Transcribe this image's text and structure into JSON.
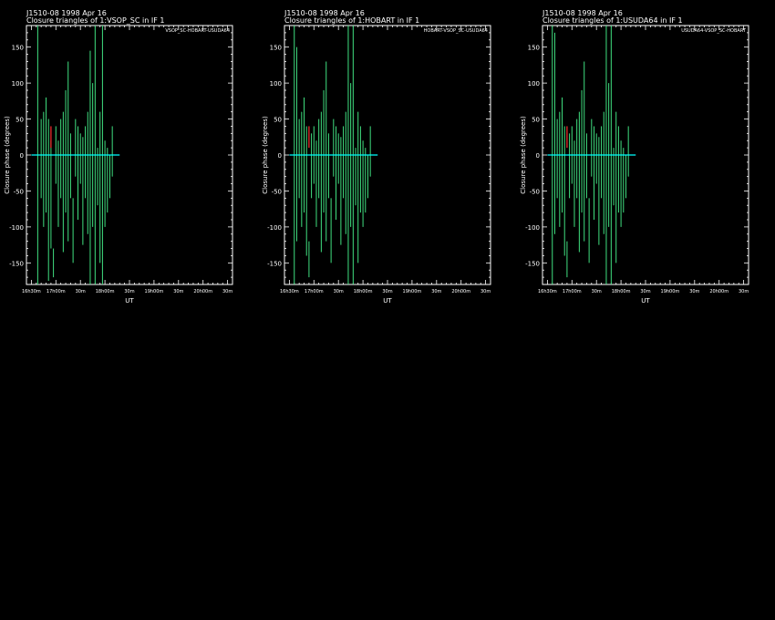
{
  "panels": [
    {
      "source_line": "J1510-08   1998 Apr 16",
      "title": "Closure triangles of 1:VSOP_SC in IF 1",
      "triangle_label": "VSOP_SC-HOBART-USUDA64",
      "zero_line_color": "#00ffff",
      "series_color": "#40e080",
      "marker_color": "#ff3030",
      "chart_data": {
        "type": "scatter",
        "xlabel": "UT",
        "ylabel": "Closure phase   (degrees)",
        "xlim": [
          16.4,
          20.6
        ],
        "ylim": [
          -180,
          180
        ],
        "yticks": [
          -150,
          -100,
          -50,
          0,
          50,
          100,
          150
        ],
        "xticks": [
          {
            "t": 16.5,
            "label": "16h30m"
          },
          {
            "t": 17.0,
            "label": "17h00m"
          },
          {
            "t": 17.5,
            "label": "30m"
          },
          {
            "t": 18.0,
            "label": "18h00m"
          },
          {
            "t": 18.5,
            "label": "30m"
          },
          {
            "t": 19.0,
            "label": "19h00m"
          },
          {
            "t": 19.5,
            "label": "30m"
          },
          {
            "t": 20.0,
            "label": "20h00m"
          },
          {
            "t": 20.5,
            "label": "30m"
          }
        ],
        "zero_line_x": [
          16.5,
          18.3
        ],
        "segments": [
          [
            16.6,
            -170
          ],
          [
            16.63,
            -180,
            180
          ],
          [
            16.7,
            -60,
            50
          ],
          [
            16.75,
            -100,
            60
          ],
          [
            16.8,
            -80,
            80
          ],
          [
            16.85,
            -175,
            50
          ],
          [
            16.9,
            -130,
            20
          ],
          [
            16.95,
            -170,
            -130
          ],
          [
            17.0,
            -40,
            40
          ],
          [
            17.05,
            -100,
            20
          ],
          [
            17.1,
            -60,
            50
          ],
          [
            17.15,
            -135,
            60
          ],
          [
            17.2,
            -80,
            90
          ],
          [
            17.25,
            -120,
            130
          ],
          [
            17.3,
            -60,
            30
          ],
          [
            17.35,
            -150,
            -60
          ],
          [
            17.4,
            -30,
            50
          ],
          [
            17.45,
            -90,
            40
          ],
          [
            17.5,
            -40,
            30
          ],
          [
            17.55,
            -125,
            25
          ],
          [
            17.6,
            -60,
            40
          ],
          [
            17.65,
            -110,
            60
          ],
          [
            17.7,
            -180,
            145
          ],
          [
            17.75,
            -100,
            100
          ],
          [
            17.8,
            -180,
            180
          ],
          [
            17.85,
            -70,
            10
          ],
          [
            17.9,
            -150,
            60
          ],
          [
            17.95,
            -180,
            180
          ],
          [
            18.0,
            -100,
            20
          ],
          [
            18.05,
            -80,
            10
          ],
          [
            18.1,
            -60,
            0
          ],
          [
            18.15,
            -30,
            40
          ]
        ],
        "markers": [
          [
            16.9,
            10,
            40
          ]
        ]
      }
    },
    {
      "source_line": "J1510-08   1998 Apr 16",
      "title": "Closure triangles of 1:HOBART in IF 1",
      "triangle_label": "HOBART-VSOP_SC-USUDA64",
      "zero_line_color": "#00ffff",
      "series_color": "#40e080",
      "marker_color": "#ff3030",
      "chart_data": {
        "type": "scatter",
        "xlabel": "UT",
        "ylabel": "Closure phase   (degrees)",
        "xlim": [
          16.4,
          20.6
        ],
        "ylim": [
          -180,
          180
        ],
        "yticks": [
          -150,
          -100,
          -50,
          0,
          50,
          100,
          150
        ],
        "xticks": [
          {
            "t": 16.5,
            "label": "16h30m"
          },
          {
            "t": 17.0,
            "label": "17h00m"
          },
          {
            "t": 17.5,
            "label": "30m"
          },
          {
            "t": 18.0,
            "label": "18h00m"
          },
          {
            "t": 18.5,
            "label": "30m"
          },
          {
            "t": 19.0,
            "label": "19h00m"
          },
          {
            "t": 19.5,
            "label": "30m"
          },
          {
            "t": 20.0,
            "label": "20h00m"
          },
          {
            "t": 20.5,
            "label": "30m"
          }
        ],
        "zero_line_x": [
          16.5,
          18.3
        ],
        "segments": [
          [
            16.6,
            -180,
            180
          ],
          [
            16.65,
            -120,
            150
          ],
          [
            16.7,
            -60,
            50
          ],
          [
            16.75,
            -100,
            60
          ],
          [
            16.8,
            -80,
            80
          ],
          [
            16.85,
            -140,
            40
          ],
          [
            16.9,
            -170,
            -120
          ],
          [
            16.95,
            -60,
            30
          ],
          [
            17.0,
            -40,
            40
          ],
          [
            17.05,
            -100,
            20
          ],
          [
            17.1,
            -60,
            50
          ],
          [
            17.15,
            -135,
            60
          ],
          [
            17.2,
            -80,
            90
          ],
          [
            17.25,
            -120,
            130
          ],
          [
            17.3,
            -60,
            30
          ],
          [
            17.35,
            -150,
            -60
          ],
          [
            17.4,
            -30,
            50
          ],
          [
            17.45,
            -90,
            40
          ],
          [
            17.5,
            -40,
            30
          ],
          [
            17.55,
            -125,
            25
          ],
          [
            17.6,
            -60,
            40
          ],
          [
            17.65,
            -110,
            60
          ],
          [
            17.7,
            -180,
            180
          ],
          [
            17.75,
            -100,
            100
          ],
          [
            17.8,
            -180,
            180
          ],
          [
            17.85,
            -70,
            10
          ],
          [
            17.9,
            -150,
            60
          ],
          [
            17.95,
            -80,
            40
          ],
          [
            18.0,
            -100,
            20
          ],
          [
            18.05,
            -80,
            10
          ],
          [
            18.1,
            -60,
            0
          ],
          [
            18.15,
            -30,
            40
          ]
        ],
        "markers": [
          [
            16.9,
            10,
            40
          ]
        ]
      }
    },
    {
      "source_line": "J1510-08   1998 Apr 16",
      "title": "Closure triangles of 1:USUDA64 in IF 1",
      "triangle_label": "USUDA64-VSOP_SC-HOBART",
      "zero_line_color": "#00ffff",
      "series_color": "#40e080",
      "marker_color": "#ff3030",
      "chart_data": {
        "type": "scatter",
        "xlabel": "UT",
        "ylabel": "Closure phase   (degrees)",
        "xlim": [
          16.4,
          20.6
        ],
        "ylim": [
          -180,
          180
        ],
        "yticks": [
          -150,
          -100,
          -50,
          0,
          50,
          100,
          150
        ],
        "xticks": [
          {
            "t": 16.5,
            "label": "16h30m"
          },
          {
            "t": 17.0,
            "label": "17h00m"
          },
          {
            "t": 17.5,
            "label": "30m"
          },
          {
            "t": 18.0,
            "label": "18h00m"
          },
          {
            "t": 18.5,
            "label": "30m"
          },
          {
            "t": 19.0,
            "label": "19h00m"
          },
          {
            "t": 19.5,
            "label": "30m"
          },
          {
            "t": 20.0,
            "label": "20h00m"
          },
          {
            "t": 20.5,
            "label": "30m"
          }
        ],
        "zero_line_x": [
          16.5,
          18.3
        ],
        "segments": [
          [
            16.6,
            -180,
            180
          ],
          [
            16.65,
            -110,
            170
          ],
          [
            16.7,
            -60,
            50
          ],
          [
            16.75,
            -100,
            60
          ],
          [
            16.8,
            -80,
            80
          ],
          [
            16.85,
            -140,
            40
          ],
          [
            16.9,
            -170,
            -120
          ],
          [
            16.95,
            -60,
            30
          ],
          [
            17.0,
            -40,
            40
          ],
          [
            17.05,
            -100,
            20
          ],
          [
            17.1,
            -60,
            50
          ],
          [
            17.15,
            -135,
            60
          ],
          [
            17.2,
            -80,
            90
          ],
          [
            17.25,
            -120,
            130
          ],
          [
            17.3,
            -60,
            30
          ],
          [
            17.35,
            -150,
            -60
          ],
          [
            17.4,
            -30,
            50
          ],
          [
            17.45,
            -90,
            40
          ],
          [
            17.5,
            -40,
            30
          ],
          [
            17.55,
            -125,
            25
          ],
          [
            17.6,
            -60,
            40
          ],
          [
            17.65,
            -110,
            60
          ],
          [
            17.7,
            -180,
            180
          ],
          [
            17.75,
            -100,
            100
          ],
          [
            17.8,
            -180,
            180
          ],
          [
            17.85,
            -70,
            10
          ],
          [
            17.9,
            -150,
            60
          ],
          [
            17.95,
            -80,
            40
          ],
          [
            18.0,
            -100,
            20
          ],
          [
            18.05,
            -80,
            10
          ],
          [
            18.1,
            -60,
            0
          ],
          [
            18.15,
            -30,
            40
          ]
        ],
        "markers": [
          [
            16.9,
            10,
            40
          ]
        ]
      }
    }
  ]
}
